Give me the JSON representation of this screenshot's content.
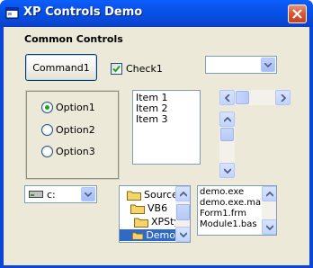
{
  "window": {
    "title": "XP Controls Demo"
  },
  "main": {
    "section_label": "Common Controls",
    "command_button_label": "Command1",
    "checkbox_label": "Check1",
    "checkbox_checked": true,
    "combo_value": "",
    "options": [
      {
        "label": "Option1",
        "selected": true
      },
      {
        "label": "Option2",
        "selected": false
      },
      {
        "label": "Option3",
        "selected": false
      }
    ],
    "listbox_items": [
      "Item 1",
      "Item 2",
      "Item 3"
    ],
    "drive_value": "c:",
    "dir_items": [
      "Source",
      "VB6",
      "XPSty",
      "Demo"
    ],
    "file_items": [
      "demo.exe",
      "demo.exe.manife",
      "Form1.frm",
      "Module1.bas"
    ]
  },
  "colors": {
    "titlebar": "#0a47d6",
    "face": "#ece9d8",
    "selection": "#316ac5",
    "close": "#d9583b"
  },
  "icons": [
    "app-window-icon",
    "close-icon",
    "dropdown-arrow-icon",
    "checkmark-icon",
    "drive-icon",
    "folder-icon",
    "scroll-arrow-icon"
  ]
}
